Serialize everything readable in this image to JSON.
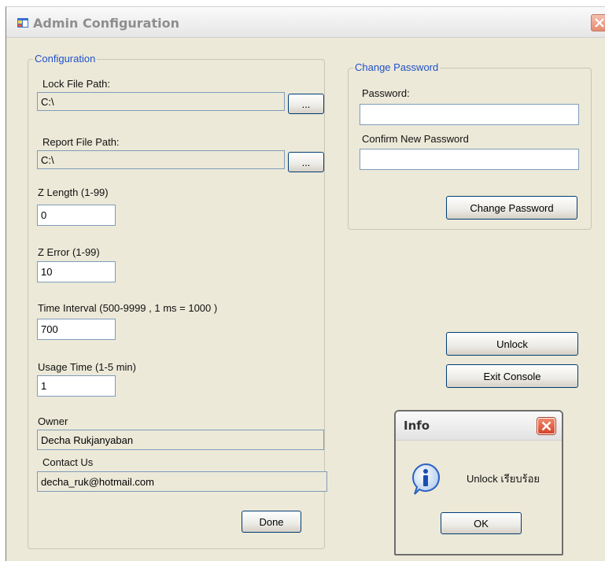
{
  "window": {
    "title": "Admin Configuration"
  },
  "config": {
    "legend": "Configuration",
    "lock_file_path_label": "Lock File Path:",
    "lock_file_path_value": "C:\\",
    "report_file_path_label": "Report File Path:",
    "report_file_path_value": "C:\\",
    "browse_label": "...",
    "z_length_label": "Z Length (1-99)",
    "z_length_value": "0",
    "z_error_label": "Z Error (1-99)",
    "z_error_value": "10",
    "time_interval_label": "Time Interval (500-9999 , 1 ms = 1000 )",
    "time_interval_value": "700",
    "usage_time_label": "Usage Time (1-5 min)",
    "usage_time_value": "1",
    "owner_label": "Owner",
    "owner_value": "Decha Rukjanyaban",
    "contact_label": "Contact Us",
    "contact_value": "decha_ruk@hotmail.com",
    "done_label": "Done"
  },
  "change_password": {
    "legend": "Change Password",
    "password_label": "Password:",
    "password_value": "",
    "confirm_label": "Confirm New Password",
    "confirm_value": "",
    "button_label": "Change Password"
  },
  "actions": {
    "unlock_label": "Unlock",
    "exit_label": "Exit Console"
  },
  "info_dialog": {
    "title": "Info",
    "message": "Unlock เรียบร้อย",
    "ok_label": "OK"
  },
  "colors": {
    "window_bg": "#ece9d8",
    "legend_blue": "#1f50c8",
    "close_red": "#d5452a"
  }
}
